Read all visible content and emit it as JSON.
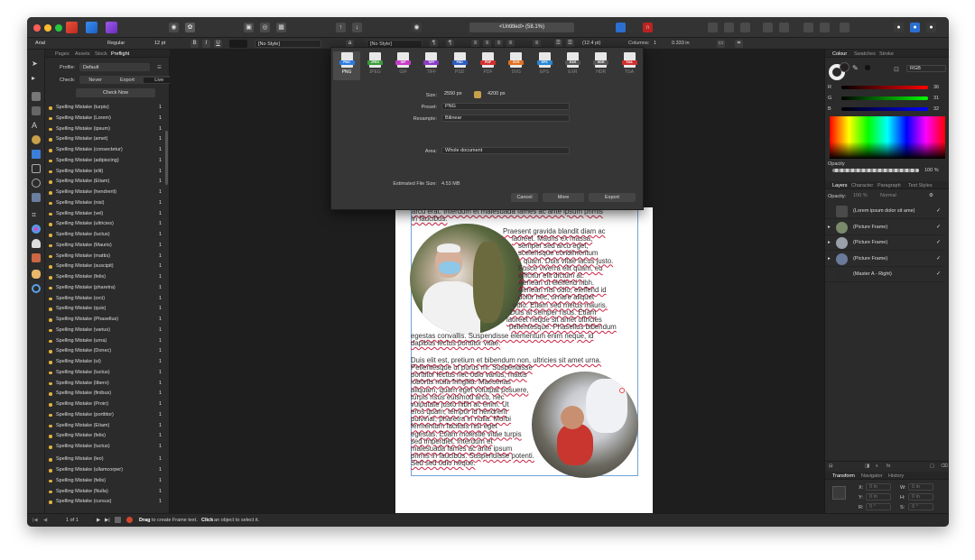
{
  "app": {
    "doc_title": "<Untitled> (58.1%)"
  },
  "context_bar": {
    "font": "Arial",
    "style": "Regular",
    "size": "12 pt",
    "bold": "B",
    "italic": "I",
    "underline": "U",
    "char_style": "[No Style]",
    "para_style": "[No Style]",
    "leading": "(12.4 pt)",
    "columns_label": "Columns:",
    "columns_value": "1",
    "gutter": "0.333 in"
  },
  "left_panel": {
    "tabs": [
      "Pages",
      "Assets",
      "Stock",
      "Preflight"
    ],
    "profile_label": "Profile:",
    "profile_value": "Default",
    "check_label": "Check:",
    "check_options": [
      "Never",
      "Export",
      "Live"
    ],
    "check_now": "Check Now",
    "issues": [
      {
        "text": "Spelling Mistake (turpis)",
        "count": "1"
      },
      {
        "text": "Spelling Mistake (Lorem)",
        "count": "1"
      },
      {
        "text": "Spelling Mistake (ipsum)",
        "count": "1"
      },
      {
        "text": "Spelling Mistake (amet)",
        "count": "1"
      },
      {
        "text": "Spelling Mistake (consectetur)",
        "count": "1"
      },
      {
        "text": "Spelling Mistake (adipiscing)",
        "count": "1"
      },
      {
        "text": "Spelling Mistake (elit)",
        "count": "1"
      },
      {
        "text": "Spelling Mistake (Etiam)",
        "count": "1"
      },
      {
        "text": "Spelling Mistake (hendrerit)",
        "count": "1"
      },
      {
        "text": "Spelling Mistake (nisi)",
        "count": "1"
      },
      {
        "text": "Spelling Mistake (vel)",
        "count": "1"
      },
      {
        "text": "Spelling Mistake (ultricies)",
        "count": "1"
      },
      {
        "text": "Spelling Mistake (luctus)",
        "count": "1"
      },
      {
        "text": "Spelling Mistake (Mauris)",
        "count": "1"
      },
      {
        "text": "Spelling Mistake (mattis)",
        "count": "1"
      },
      {
        "text": "Spelling Mistake (suscipit)",
        "count": "1"
      },
      {
        "text": "Spelling Mistake (felis)",
        "count": "1"
      },
      {
        "text": "Spelling Mistake (pharetra)",
        "count": "1"
      },
      {
        "text": "Spelling Mistake (orci)",
        "count": "1"
      },
      {
        "text": "Spelling Mistake (quis)",
        "count": "1"
      },
      {
        "text": "Spelling Mistake (Phasellus)",
        "count": "1"
      },
      {
        "text": "Spelling Mistake (varius)",
        "count": "1"
      },
      {
        "text": "Spelling Mistake (urna)",
        "count": "1"
      },
      {
        "text": "Spelling Mistake (Donec)",
        "count": "1"
      },
      {
        "text": "Spelling Mistake (ut)",
        "count": "1"
      },
      {
        "text": "Spelling Mistake (luctus)",
        "count": "1"
      },
      {
        "text": "Spelling Mistake (libero)",
        "count": "1"
      },
      {
        "text": "Spelling Mistake (finibus)",
        "count": "1"
      },
      {
        "text": "Spelling Mistake (Proin)",
        "count": "1"
      },
      {
        "text": "Spelling Mistake (porttitor)",
        "count": "1"
      },
      {
        "text": "Spelling Mistake (Etiam)",
        "count": "1"
      },
      {
        "text": "Spelling Mistake (felis)",
        "count": "1"
      },
      {
        "text": "Spelling Mistake (luctus)",
        "count": "1"
      },
      {
        "text": "Spelling Mistake (leo)",
        "count": "1"
      },
      {
        "text": "Spelling Mistake (ullamcorper)",
        "count": "1"
      },
      {
        "text": "Spelling Mistake (felis)",
        "count": "1"
      },
      {
        "text": "Spelling Mistake (Nulla)",
        "count": "1"
      },
      {
        "text": "Spelling Mistake (cursus)",
        "count": "1"
      }
    ]
  },
  "export_dialog": {
    "formats": [
      {
        "name": "PNG",
        "color": "#2c7be0",
        "active": true
      },
      {
        "name": "JPEG",
        "color": "#3b9b3b"
      },
      {
        "name": "GIF",
        "color": "#c63cc6"
      },
      {
        "name": "TIFF",
        "color": "#8a3cc6"
      },
      {
        "name": "PSD",
        "color": "#2a5cc0"
      },
      {
        "name": "PDF",
        "color": "#d23030"
      },
      {
        "name": "SVG",
        "color": "#e07020"
      },
      {
        "name": "EPS",
        "color": "#2a86d0"
      },
      {
        "name": "EXR",
        "color": "#555555"
      },
      {
        "name": "HDR",
        "color": "#555555"
      },
      {
        "name": "TGA",
        "color": "#d23030"
      }
    ],
    "size_label": "Size:",
    "width": "2550 px",
    "height": "4200 px",
    "preset_label": "Preset:",
    "preset_value": "PNG",
    "resample_label": "Resample:",
    "resample_value": "Bilinear",
    "area_label": "Area:",
    "area_value": "Whole document",
    "filesize_label": "Estimated File Size:",
    "filesize_value": "4.53 MB",
    "cancel": "Cancel",
    "more": "More",
    "export": "Export"
  },
  "page_text": {
    "line0": "arcu erat. Interdum et malesuada fames ac ante ipsum primis",
    "line1": "in faucibus.",
    "p1": [
      "Praesent gravida blandit diam ac",
      "laoreet. Mauris ex massa,",
      "semper sed arcu eget,",
      "scelerisque condimentum",
      "quam. Duis vitae lacus justo.",
      "Fusce viverra elit quam, eu",
      "efficitur elit dictum at.",
      "Aenean ut eleifend nibh.",
      "Aenean nisi odio, eleifend id",
      "dolor nec, ornare aliquet",
      "odio. Etiam sed metus mauris.",
      "Duis at semper risus. Etiam",
      "laoreet neque sit amet ultricies",
      "pellentesque. Phasellus bibendum"
    ],
    "p1_end": [
      "egestas convallis. Suspendisse elementum enim neque, id",
      "dapibus lectus porttitor vitae."
    ],
    "p2": [
      "Duis elit est, pretium et bibendum non, ultricies sit amet urna.",
      "Pellentesque ut purus mi. Suspendisse",
      "porttitor lectus nec odio varius, mattis",
      "lobortis nulla fringilla. Maecenas",
      "aliquam, quam eget volutpat posuere,",
      "turpis risus euismod arcu, nec",
      "vulputate justo nibh ac enim. Ut",
      "eros quam, tempor id hendrerit",
      "pulvinar, pharetra in nulla. Morbi",
      "fermentum facilisis nisi eget",
      "egestas. Etiam molestie vitae turpis",
      "sed imperdiet. Interdum et",
      "malesuada fames ac ante ipsum",
      "primis in faucibus. Suspendisse potenti.",
      "Sed sed odio neque."
    ]
  },
  "right_panel": {
    "top_tabs": [
      "Colour",
      "Swatches",
      "Stroke"
    ],
    "color_model": "RGB",
    "r_label": "R",
    "r_value": "36",
    "g_label": "G",
    "g_value": "31",
    "b_label": "B",
    "b_value": "32",
    "opacity_label": "Opacity",
    "opacity_value": "100 %",
    "layer_tabs": [
      "Layers",
      "Character",
      "Paragraph",
      "Text Styles"
    ],
    "layer_opacity_label": "Opacity:",
    "layer_opacity_value": "100 %",
    "blend_mode": "Normal",
    "layers": [
      {
        "name": "(Lorem ipsum dolor sit ame)"
      },
      {
        "name": "(Picture Frame)"
      },
      {
        "name": "(Picture Frame)"
      },
      {
        "name": "(Picture Frame)"
      },
      {
        "name": "(Master A - Right)"
      }
    ],
    "bottom_tabs": [
      "Transform",
      "Navigator",
      "History"
    ],
    "x_label": "X:",
    "x_value": "0 in",
    "y_label": "Y:",
    "y_value": "0 in",
    "w_label": "W:",
    "w_value": "0 in",
    "h_label": "H:",
    "h_value": "0 in",
    "r_rot_label": "R:",
    "r_rot_value": "0 °",
    "s_label": "S:",
    "s_value": "0 °"
  },
  "status_bar": {
    "page": "1 of 1",
    "drag": "Drag",
    "hint1": "to create Frame text.",
    "click": "Click",
    "hint2": "an object to select it."
  }
}
